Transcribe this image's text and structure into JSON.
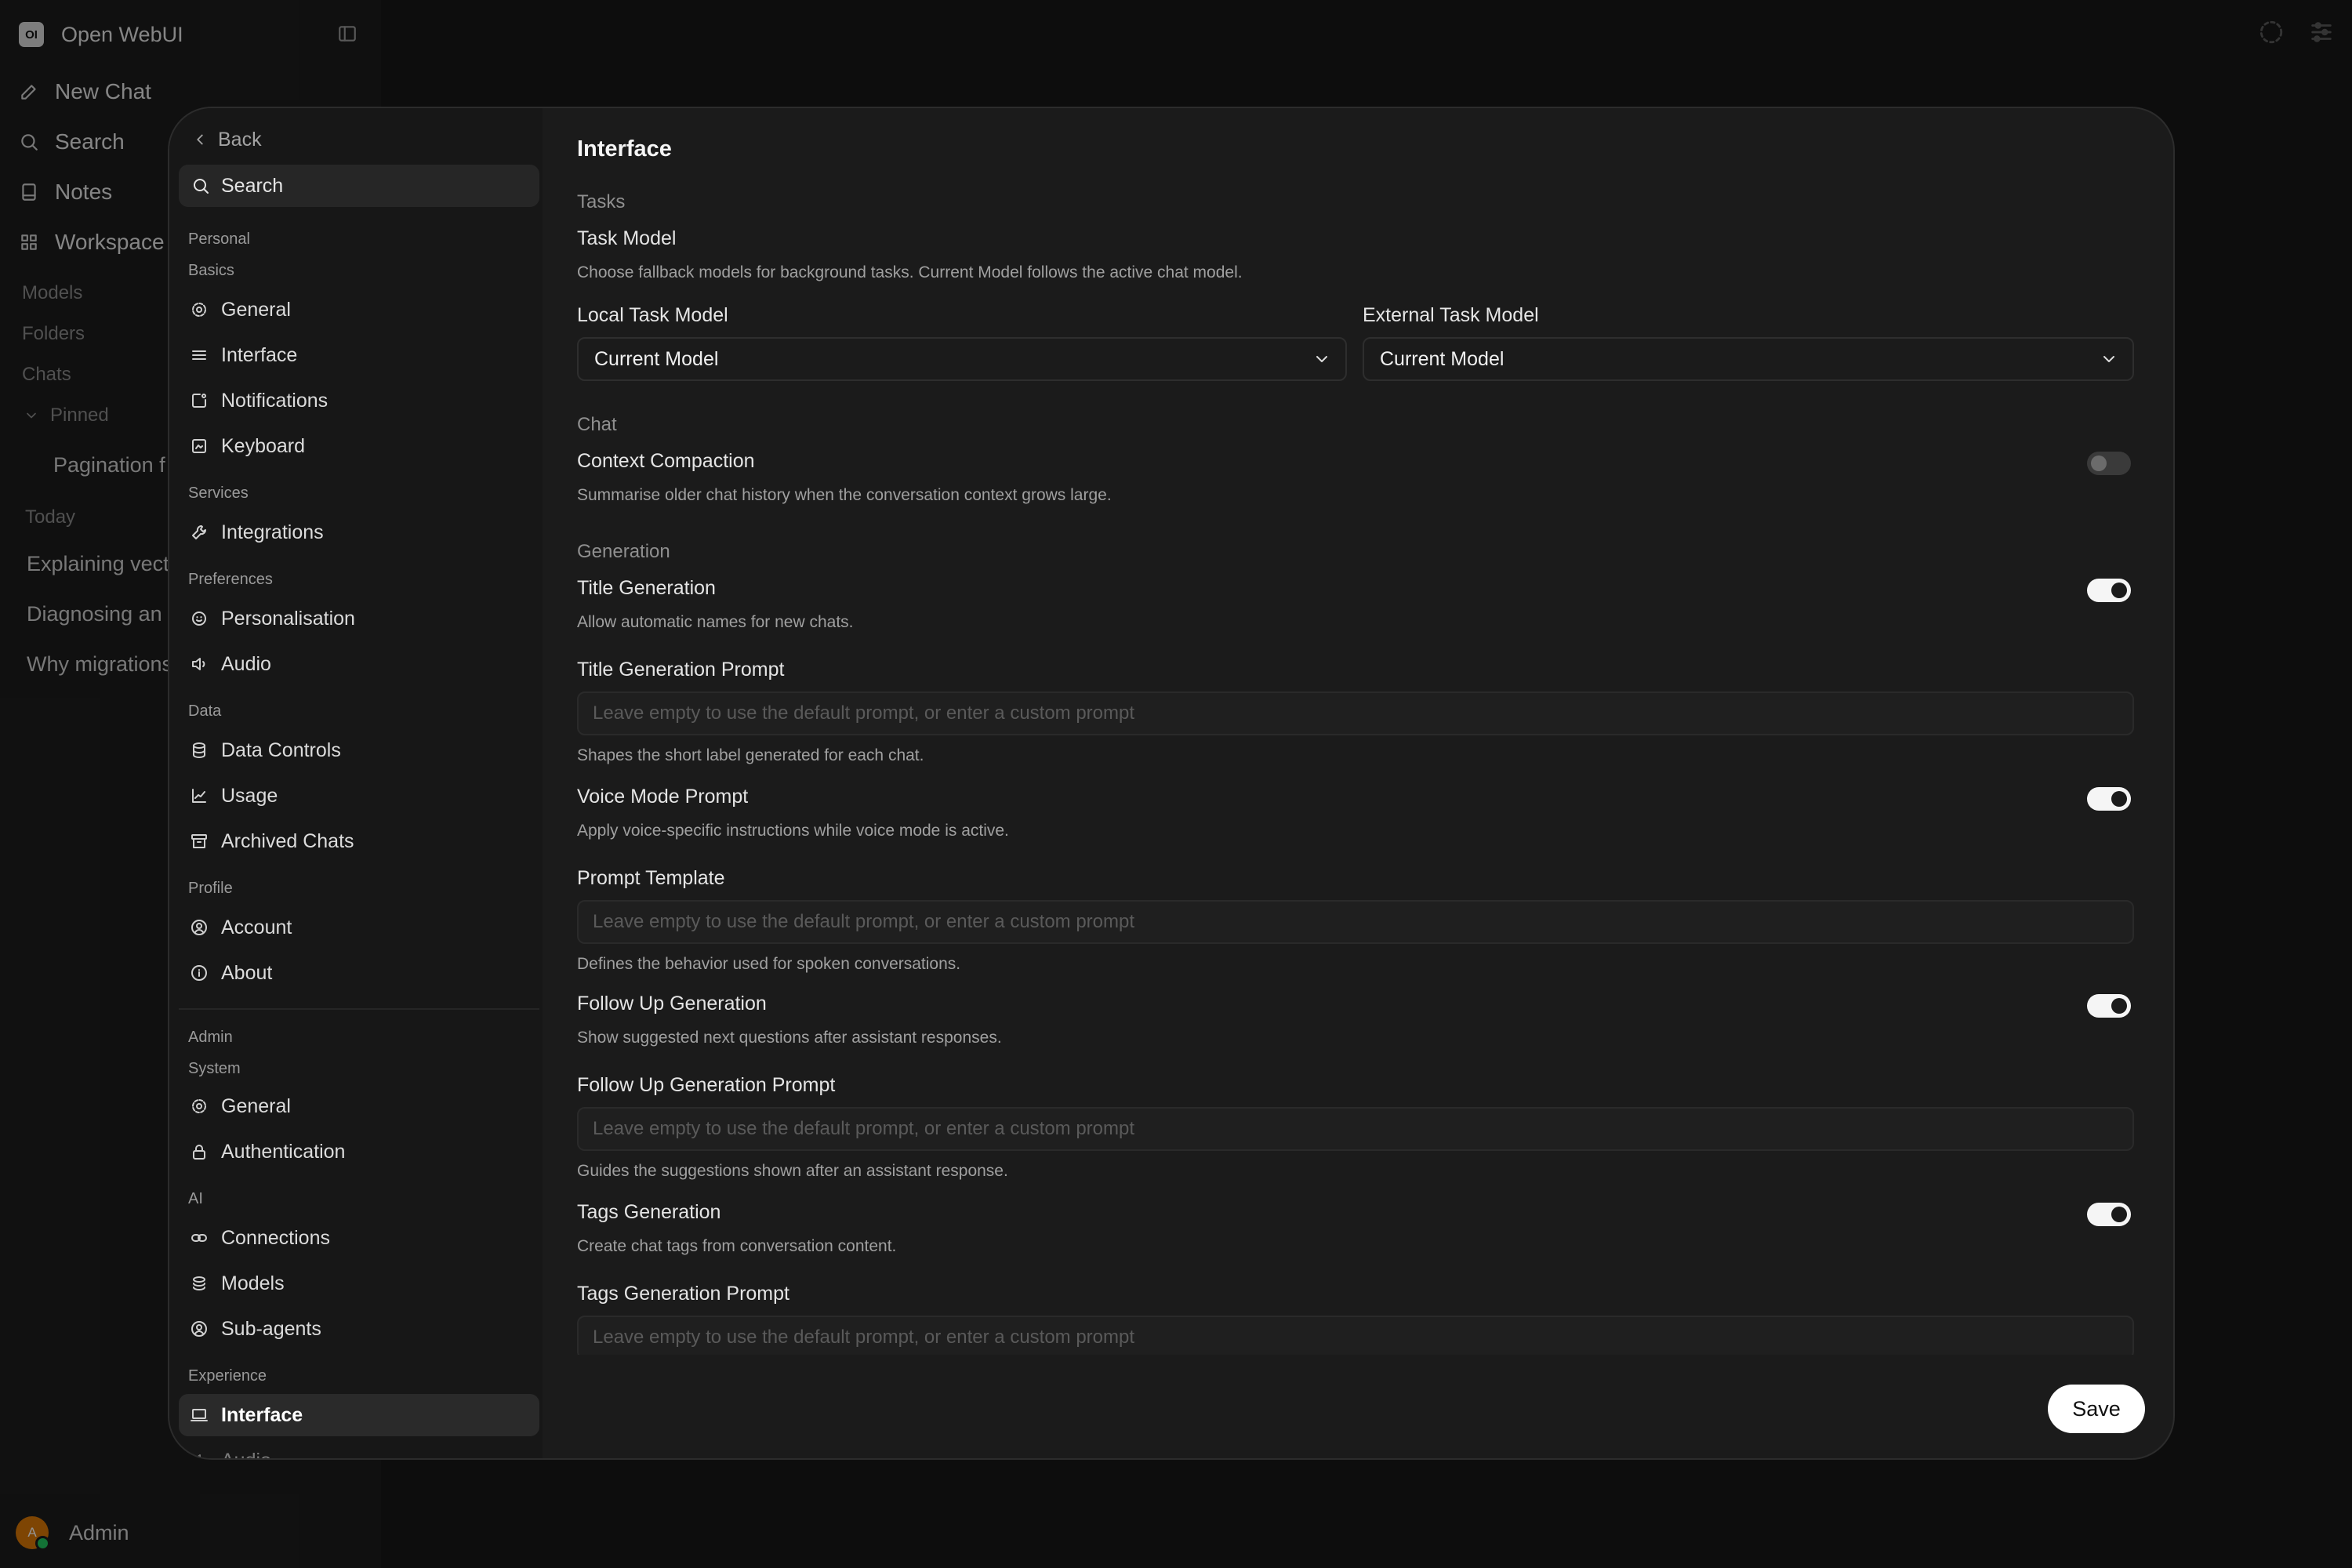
{
  "app": {
    "logo_text": "OI",
    "title": "Open WebUI"
  },
  "sidebar": {
    "nav": [
      {
        "label": "New Chat",
        "icon": "pencil-icon"
      },
      {
        "label": "Search",
        "icon": "search-icon"
      },
      {
        "label": "Notes",
        "icon": "note-icon"
      },
      {
        "label": "Workspace",
        "icon": "grid-icon"
      }
    ],
    "sections": {
      "models": "Models",
      "folders": "Folders",
      "chats": "Chats",
      "pinned": "Pinned",
      "today": "Today"
    },
    "pinned_chat": "Pagination f",
    "today_chats": [
      "Explaining vect",
      "Diagnosing an",
      "Why migrations"
    ],
    "user": {
      "initial": "A",
      "name": "Admin"
    }
  },
  "settings_nav": {
    "back": "Back",
    "search": "Search",
    "groups": {
      "personal": "Personal",
      "basics": "Basics",
      "services": "Services",
      "preferences": "Preferences",
      "data": "Data",
      "profile": "Profile",
      "admin": "Admin",
      "system": "System",
      "ai": "AI",
      "experience": "Experience"
    },
    "items": {
      "general": "General",
      "interface": "Interface",
      "notifications": "Notifications",
      "keyboard": "Keyboard",
      "integrations": "Integrations",
      "personalisation": "Personalisation",
      "audio": "Audio",
      "data_controls": "Data Controls",
      "usage": "Usage",
      "archived_chats": "Archived Chats",
      "account": "Account",
      "about": "About",
      "admin_general": "General",
      "authentication": "Authentication",
      "connections": "Connections",
      "models": "Models",
      "sub_agents": "Sub-agents",
      "exp_interface": "Interface",
      "exp_audio": "Audio"
    }
  },
  "content": {
    "title": "Interface",
    "tasks": {
      "section": "Tasks",
      "task_model": "Task Model",
      "task_model_desc": "Choose fallback models for background tasks. Current Model follows the active chat model.",
      "local_label": "Local Task Model",
      "local_value": "Current Model",
      "external_label": "External Task Model",
      "external_value": "Current Model"
    },
    "chat": {
      "section": "Chat",
      "compaction_label": "Context Compaction",
      "compaction_desc": "Summarise older chat history when the conversation context grows large.",
      "compaction_on": false
    },
    "generation": {
      "section": "Generation",
      "title_gen": "Title Generation",
      "title_gen_desc": "Allow automatic names for new chats.",
      "title_gen_on": true,
      "title_prompt": "Title Generation Prompt",
      "title_prompt_desc": "Shapes the short label generated for each chat.",
      "voice": "Voice Mode Prompt",
      "voice_desc": "Apply voice-specific instructions while voice mode is active.",
      "voice_on": true,
      "prompt_template": "Prompt Template",
      "prompt_template_desc": "Defines the behavior used for spoken conversations.",
      "follow_up": "Follow Up Generation",
      "follow_up_desc": "Show suggested next questions after assistant responses.",
      "follow_up_on": true,
      "follow_up_prompt": "Follow Up Generation Prompt",
      "follow_up_prompt_desc": "Guides the suggestions shown after an assistant response.",
      "tags": "Tags Generation",
      "tags_desc": "Create chat tags from conversation content.",
      "tags_on": true,
      "tags_prompt": "Tags Generation Prompt"
    },
    "placeholder": "Leave empty to use the default prompt, or enter a custom prompt"
  },
  "save": "Save"
}
